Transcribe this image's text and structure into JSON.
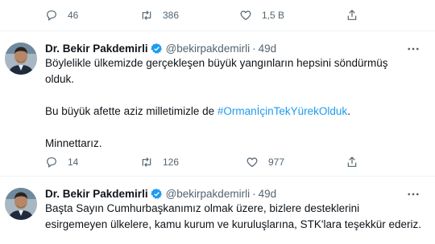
{
  "top_actions": {
    "reply_count": "46",
    "retweet_count": "386",
    "like_count": "1,5 B"
  },
  "tweet1": {
    "display_name": "Dr. Bekir Pakdemirli",
    "handle": "@bekirpakdemirli",
    "separator": "·",
    "time": "49d",
    "line1": "Böylelikle ülkemizde gerçekleşen büyük yangınların hepsini söndürmüş",
    "line2": "olduk.",
    "line3_prefix": "Bu büyük afette aziz milletimizle de ",
    "hashtag": "#OrmanİçinTekYürekOlduk",
    "line3_suffix": ".",
    "line4": "Minnettarız.",
    "reply_count": "14",
    "retweet_count": "126",
    "like_count": "977"
  },
  "tweet2": {
    "display_name": "Dr. Bekir Pakdemirli",
    "handle": "@bekirpakdemirli",
    "separator": "·",
    "time": "49d",
    "line1": "Başta Sayın Cumhurbaşkanımız olmak üzere, bizlere desteklerini",
    "line2": "esirgemeyen ülkelere, kamu kurum ve kuruluşlarına, STK'lara teşekkür ederiz."
  },
  "icons": {
    "reply": "reply-icon",
    "retweet": "retweet-icon",
    "like": "heart-icon",
    "share": "share-icon",
    "verified": "verified-badge-icon",
    "more": "more-options-icon"
  },
  "colors": {
    "accent": "#1d9bf0",
    "muted": "#536471",
    "text": "#0f1419"
  }
}
